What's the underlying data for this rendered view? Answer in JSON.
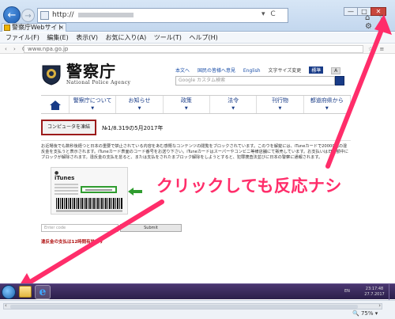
{
  "browser": {
    "address": "http://",
    "tab_title": "警察庁Webサイト",
    "tab_close": "×",
    "inner_url": "www.npa.go.jp",
    "window_buttons": [
      "—",
      "□",
      "✕"
    ],
    "nav_glyphs": "‹ › C",
    "addr_tools": "▾ C",
    "ie_icons": "⌂ ☆ ⚙",
    "inner_icons": "☆ ≡"
  },
  "menubar": [
    "ファイル(F)",
    "編集(E)",
    "表示(V)",
    "お気に入り(A)",
    "ツール(T)",
    "ヘルプ(H)"
  ],
  "site": {
    "logo_jp": "警察庁",
    "logo_en": "National Police Agency",
    "toplinks": [
      "本文へ",
      "国民の皆様へ意見",
      "English"
    ],
    "text_size_label": "文字サイズ変更",
    "text_size_std": "標準",
    "text_size_large": "A",
    "search_placeholder": "Google カスタム検索",
    "nav": [
      "警察庁について",
      "お知らせ",
      "政策",
      "法令",
      "刊行物",
      "都道府県から"
    ],
    "alert_button": "コンピュータを凍結",
    "alert_number": "№1/8.319の5月2017年",
    "body_text": "お近場後でも数秒後経つと日本の重要で禁止されている内容をあむ感慨なコンテンツの閲覧をブロックされています。このウを解錠には、iTuneカードで20000円の違反金を支払うと表示されます。iTuneカード表面のコード番号をお送り下さい。iTuneカードはスーパーやコンビニ等様店舗にて販売しています。お支払いは日金額中にブロックが解除されます。違反金の支払を怠ると、または支払をされたまブロック解除をしようとすると、犯罪捜査法並びに日本の警察に通報されます。",
    "card_apple": "",
    "card_title": "iTunes",
    "code_placeholder": "Enter code",
    "submit_label": "Submit",
    "deadline_text": "違反金の支払は12時間有効です"
  },
  "annotation": {
    "text": "クリックしても反応ナシ",
    "color": "#ff2d6a"
  },
  "taskbar": {
    "ie_glyph": "e",
    "lang": "EN",
    "time": "23:17:48",
    "date": "27.7.2017"
  },
  "statusbar": {
    "scroll_left": "‹",
    "scroll_right": "›",
    "zoom": "🔍 75% ▾"
  }
}
